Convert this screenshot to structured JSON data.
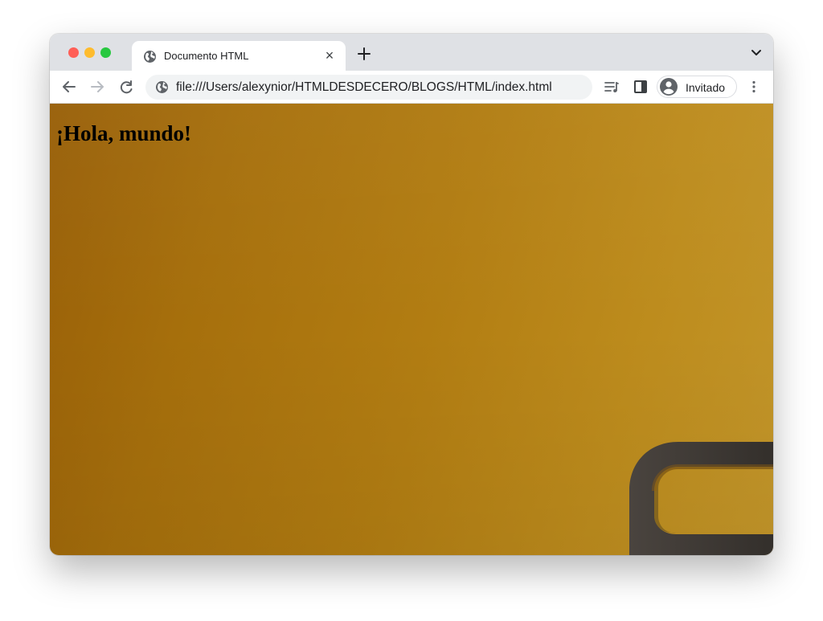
{
  "browser": {
    "tab": {
      "title": "Documento HTML",
      "favicon": "globe-icon",
      "close_icon": "×"
    },
    "new_tab_icon": "plus-icon",
    "tab_search_icon": "chevron-down-icon",
    "address_bar": {
      "icon": "globe-icon",
      "url": "file:///Users/alexynior/HTMLDESDECERO/BLOGS/HTML/index.html"
    },
    "profile": {
      "label": "Invitado",
      "icon": "avatar-icon"
    },
    "toolbar_icons": [
      "back-arrow-icon",
      "forward-arrow-icon",
      "reload-icon",
      "reading-list-icon",
      "side-panel-icon",
      "menu-dots-icon"
    ]
  },
  "page": {
    "heading": "¡Hola, mundo!"
  },
  "colors": {
    "window_close": "#ff5f57",
    "window_minimize": "#febc2e",
    "window_zoom": "#28c840",
    "tabstrip_bg": "#dfe1e5",
    "omnibox_bg": "#f1f3f4",
    "page_background_start": "#985f08",
    "page_background_end": "#c3962a",
    "decorative_shape": "#403b37"
  }
}
